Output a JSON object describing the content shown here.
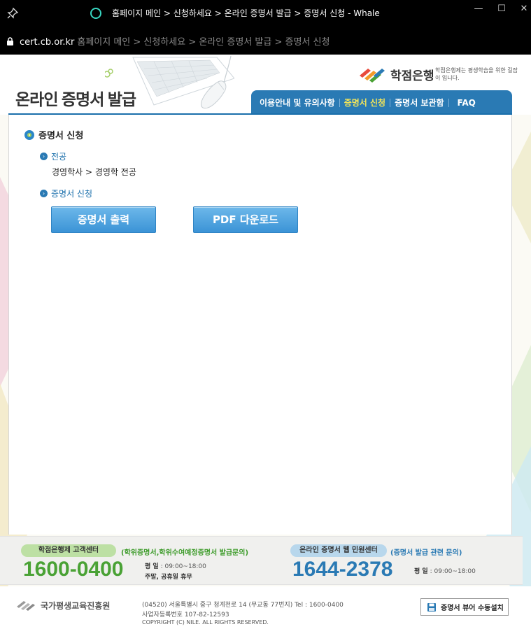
{
  "window": {
    "title": "홈페이지 메인 > 신청하세요 > 온라인 증명서 발급 > 증명서 신청 - Whale",
    "minimize": "—",
    "maximize": "☐",
    "close": "✕"
  },
  "urlbar": {
    "domain": "cert.cb.or.kr",
    "path": "홈페이지 메인 > 신청하세요 > 온라인 증명서 발급 > 증명서 신청"
  },
  "header": {
    "title": "온라인 증명서 발급",
    "logo_text": "학점은행",
    "logo_slogan": "학점은행제는 평생학습을 위한 길잡이 입니다.",
    "tabs": [
      {
        "label": "이용안내 및 유의사항",
        "active": false
      },
      {
        "label": "증명서 신청",
        "active": true
      },
      {
        "label": "증명서 보관함",
        "active": false
      },
      {
        "label": "FAQ",
        "active": false
      }
    ]
  },
  "content": {
    "section_title": "증명서 신청",
    "major_heading": "전공",
    "major_value": "경영학사 > 경영학 전공",
    "apply_heading": "증명서 신청",
    "print_button": "증명서 출력",
    "pdf_button": "PDF 다운로드"
  },
  "customer_center": {
    "credit_bank": {
      "name": "학점은행제 고객센터",
      "note": "(학위증명서,학위수여예정증명서 발급문의)",
      "phone": "1600-0400",
      "weekday_label": "평   일",
      "weekday_hours": ": 09:00~18:00",
      "weekend": "주말, 공휴일 휴무"
    },
    "online_cert": {
      "name": "온라인 증명서 웹 민원센터",
      "note": "(증명서 발급 관련 문의)",
      "phone": "1644-2378",
      "weekday_label": "평   일",
      "weekday_hours": ": 09:00~18:00"
    }
  },
  "footer": {
    "org_name": "국가평생교육진흥원",
    "address": "(04520) 서울특별시 중구 청계천로 14 (무교동 77번지)    Tel : 1600-0400",
    "biz_number": "사업자등록번호 107-82-12593",
    "copyright": "COPYRIGHT (C) NILE. ALL RIGHTS RESERVED.",
    "viewer_button": "증명서 뷰어 수동설치"
  },
  "colors": {
    "accent_blue": "#2a7ab4",
    "active_tab": "#f2e45a",
    "phone_green": "#4aa235",
    "loading": "#38d6c1"
  }
}
